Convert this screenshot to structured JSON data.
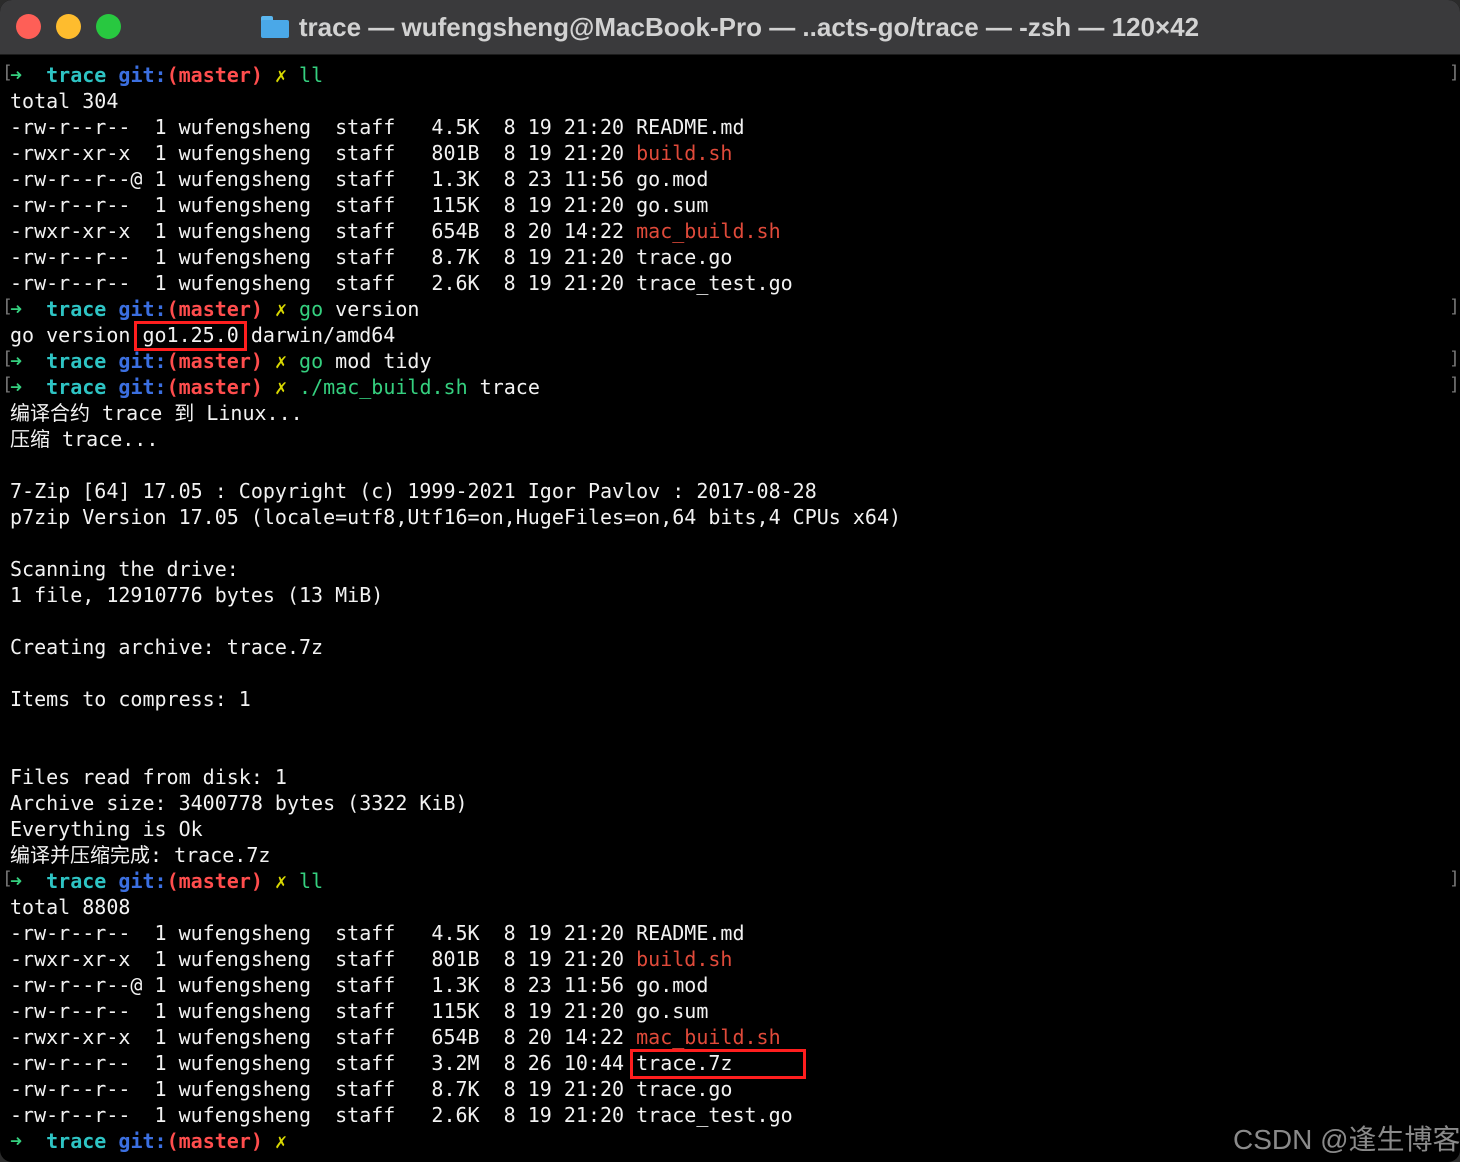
{
  "window": {
    "title": "trace — wufengsheng@MacBook-Pro — ..acts-go/trace — -zsh — 120×42",
    "icons": [
      "close-button",
      "minimize-button",
      "zoom-button",
      "folder-icon"
    ]
  },
  "prompt": {
    "arrow": "➜",
    "dir": "trace",
    "git": "git:",
    "branch": "(master)",
    "dirty": "✗"
  },
  "colors": {
    "background": "#000000",
    "text": "#f2f2f2",
    "prompt_arrow": "#35d07f",
    "prompt_dir": "#2ec4c4",
    "git_label": "#3b6fe0",
    "branch": "#ff4d4d",
    "dirty_mark": "#d8d800",
    "executable": "#e04a3a",
    "highlight_box": "#ff1e1e"
  },
  "commands": {
    "ll_1": "ll",
    "go_version_cmd": "go",
    "go_version_arg": " version",
    "go_mod_cmd": "go",
    "go_mod_arg": " mod tidy",
    "build_cmd": "./mac_build.sh",
    "build_arg": " trace",
    "ll_2": "ll"
  },
  "listing1": {
    "total": "total 304",
    "rows": [
      {
        "prefix": "-rw-r--r--  1 wufengsheng  staff   4.5K  8 19 21:20 ",
        "name": "README.md",
        "exec": false
      },
      {
        "prefix": "-rwxr-xr-x  1 wufengsheng  staff   801B  8 19 21:20 ",
        "name": "build.sh",
        "exec": true
      },
      {
        "prefix": "-rw-r--r--@ 1 wufengsheng  staff   1.3K  8 23 11:56 ",
        "name": "go.mod",
        "exec": false
      },
      {
        "prefix": "-rw-r--r--  1 wufengsheng  staff   115K  8 19 21:20 ",
        "name": "go.sum",
        "exec": false
      },
      {
        "prefix": "-rwxr-xr-x  1 wufengsheng  staff   654B  8 20 14:22 ",
        "name": "mac_build.sh",
        "exec": true
      },
      {
        "prefix": "-rw-r--r--  1 wufengsheng  staff   8.7K  8 19 21:20 ",
        "name": "trace.go",
        "exec": false
      },
      {
        "prefix": "-rw-r--r--  1 wufengsheng  staff   2.6K  8 19 21:20 ",
        "name": "trace_test.go",
        "exec": false
      }
    ]
  },
  "go_version": {
    "prefix": "go version ",
    "version": "go1.25.0",
    "suffix": " darwin/amd64"
  },
  "build_output": [
    "编译合约 trace 到 Linux...",
    "压缩 trace...",
    "",
    "7-Zip [64] 17.05 : Copyright (c) 1999-2021 Igor Pavlov : 2017-08-28",
    "p7zip Version 17.05 (locale=utf8,Utf16=on,HugeFiles=on,64 bits,4 CPUs x64)",
    "",
    "Scanning the drive:",
    "1 file, 12910776 bytes (13 MiB)",
    "",
    "Creating archive: trace.7z",
    "",
    "Items to compress: 1",
    "",
    "",
    "Files read from disk: 1",
    "Archive size: 3400778 bytes (3322 KiB)",
    "Everything is Ok",
    "编译并压缩完成: trace.7z"
  ],
  "listing2": {
    "total": "total 8808",
    "rows": [
      {
        "prefix": "-rw-r--r--  1 wufengsheng  staff   4.5K  8 19 21:20 ",
        "name": "README.md",
        "exec": false
      },
      {
        "prefix": "-rwxr-xr-x  1 wufengsheng  staff   801B  8 19 21:20 ",
        "name": "build.sh",
        "exec": true
      },
      {
        "prefix": "-rw-r--r--@ 1 wufengsheng  staff   1.3K  8 23 11:56 ",
        "name": "go.mod",
        "exec": false
      },
      {
        "prefix": "-rw-r--r--  1 wufengsheng  staff   115K  8 19 21:20 ",
        "name": "go.sum",
        "exec": false
      },
      {
        "prefix": "-rwxr-xr-x  1 wufengsheng  staff   654B  8 20 14:22 ",
        "name": "mac_build.sh",
        "exec": true
      },
      {
        "prefix": "-rw-r--r--  1 wufengsheng  staff   3.2M  8 26 10:44 ",
        "name": "trace.7z",
        "exec": false
      },
      {
        "prefix": "-rw-r--r--  1 wufengsheng  staff   8.7K  8 19 21:20 ",
        "name": "trace.go",
        "exec": false
      },
      {
        "prefix": "-rw-r--r--  1 wufengsheng  staff   2.6K  8 19 21:20 ",
        "name": "trace_test.go",
        "exec": false
      }
    ]
  },
  "watermark": "CSDN @逢生博客"
}
